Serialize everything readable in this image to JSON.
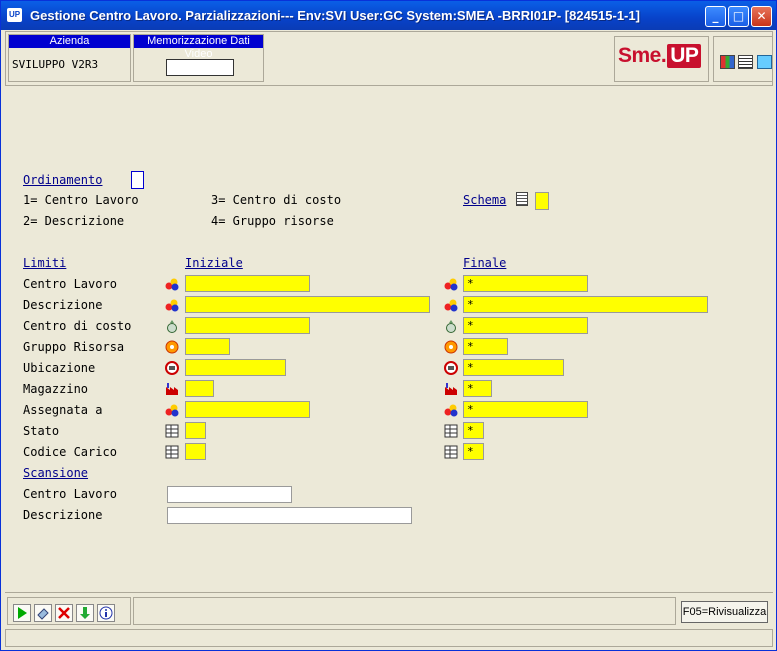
{
  "window": {
    "title": "Gestione Centro Lavoro.  Parzializzazioni--- Env:SVI User:GC System:SMEA -BRRI01P- [824515-1-1]",
    "app_icon": "UP",
    "min": "_",
    "max": "□",
    "close": "✕"
  },
  "header": {
    "azienda_caption": "Azienda",
    "azienda_value": "SVILUPPO V2R3",
    "memorizzazione_caption": "Memorizzazione Dati Video",
    "memorizzazione_value": "",
    "logo_text_a": "Sme.",
    "logo_text_b": "UP"
  },
  "ordinamento": {
    "label": "Ordinamento",
    "value": "",
    "options": [
      "1= Centro Lavoro",
      "2= Descrizione",
      "3= Centro di costo",
      "4= Gruppo risorse"
    ]
  },
  "schema": {
    "label": "Schema",
    "value": ""
  },
  "limiti": {
    "label": "Limiti",
    "col_iniziale": "Iniziale",
    "col_finale": "Finale",
    "rows": [
      {
        "label": "Centro Lavoro",
        "iniziale": "",
        "finale": "*",
        "icon": "people-icon"
      },
      {
        "label": "Descrizione",
        "iniziale": "",
        "finale": "*",
        "icon": "people-icon"
      },
      {
        "label": "Centro di costo",
        "iniziale": "",
        "finale": "*",
        "icon": "cost-center-icon"
      },
      {
        "label": "Gruppo Risorsa",
        "iniziale": "",
        "finale": "*",
        "icon": "resource-group-icon"
      },
      {
        "label": "Ubicazione",
        "iniziale": "",
        "finale": "*",
        "icon": "location-icon"
      },
      {
        "label": "Magazzino",
        "iniziale": "",
        "finale": "*",
        "icon": "warehouse-icon"
      },
      {
        "label": "Assegnata a",
        "iniziale": "",
        "finale": "*",
        "icon": "people-icon"
      },
      {
        "label": "Stato",
        "iniziale": "",
        "finale": "*",
        "icon": "table-icon"
      },
      {
        "label": "Codice Carico",
        "iniziale": "",
        "finale": "*",
        "icon": "table-icon"
      }
    ]
  },
  "scansione": {
    "label": "Scansione",
    "rows": [
      {
        "label": "Centro Lavoro",
        "value": ""
      },
      {
        "label": "Descrizione",
        "value": ""
      }
    ]
  },
  "footer": {
    "f05_label": "F05=Rivisualizza"
  },
  "colors": {
    "field_yellow": "#ffff00",
    "link_blue": "#00008b",
    "title_blue": "#0842c9"
  }
}
